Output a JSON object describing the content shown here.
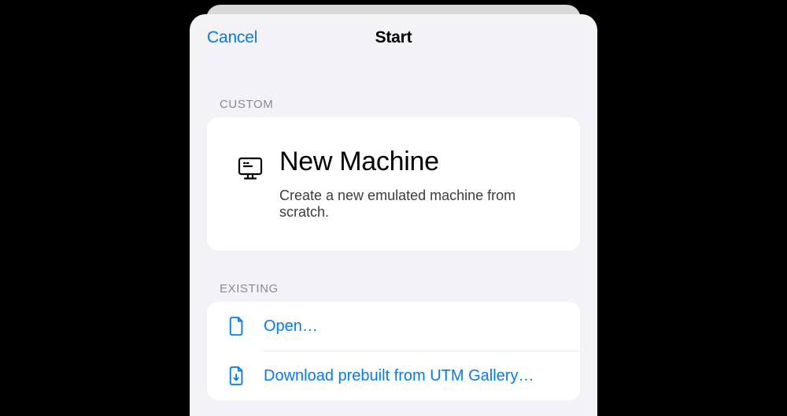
{
  "nav": {
    "cancel": "Cancel",
    "title": "Start"
  },
  "sections": {
    "custom_header": "CUSTOM",
    "existing_header": "EXISTING"
  },
  "custom": {
    "title": "New Machine",
    "subtitle": "Create a new emulated machine from scratch."
  },
  "existing": {
    "open": "Open…",
    "download": "Download prebuilt from UTM Gallery…"
  },
  "colors": {
    "tint": "#007aff",
    "sheet_bg": "#f2f2f7",
    "section_header": "#8a898e"
  }
}
